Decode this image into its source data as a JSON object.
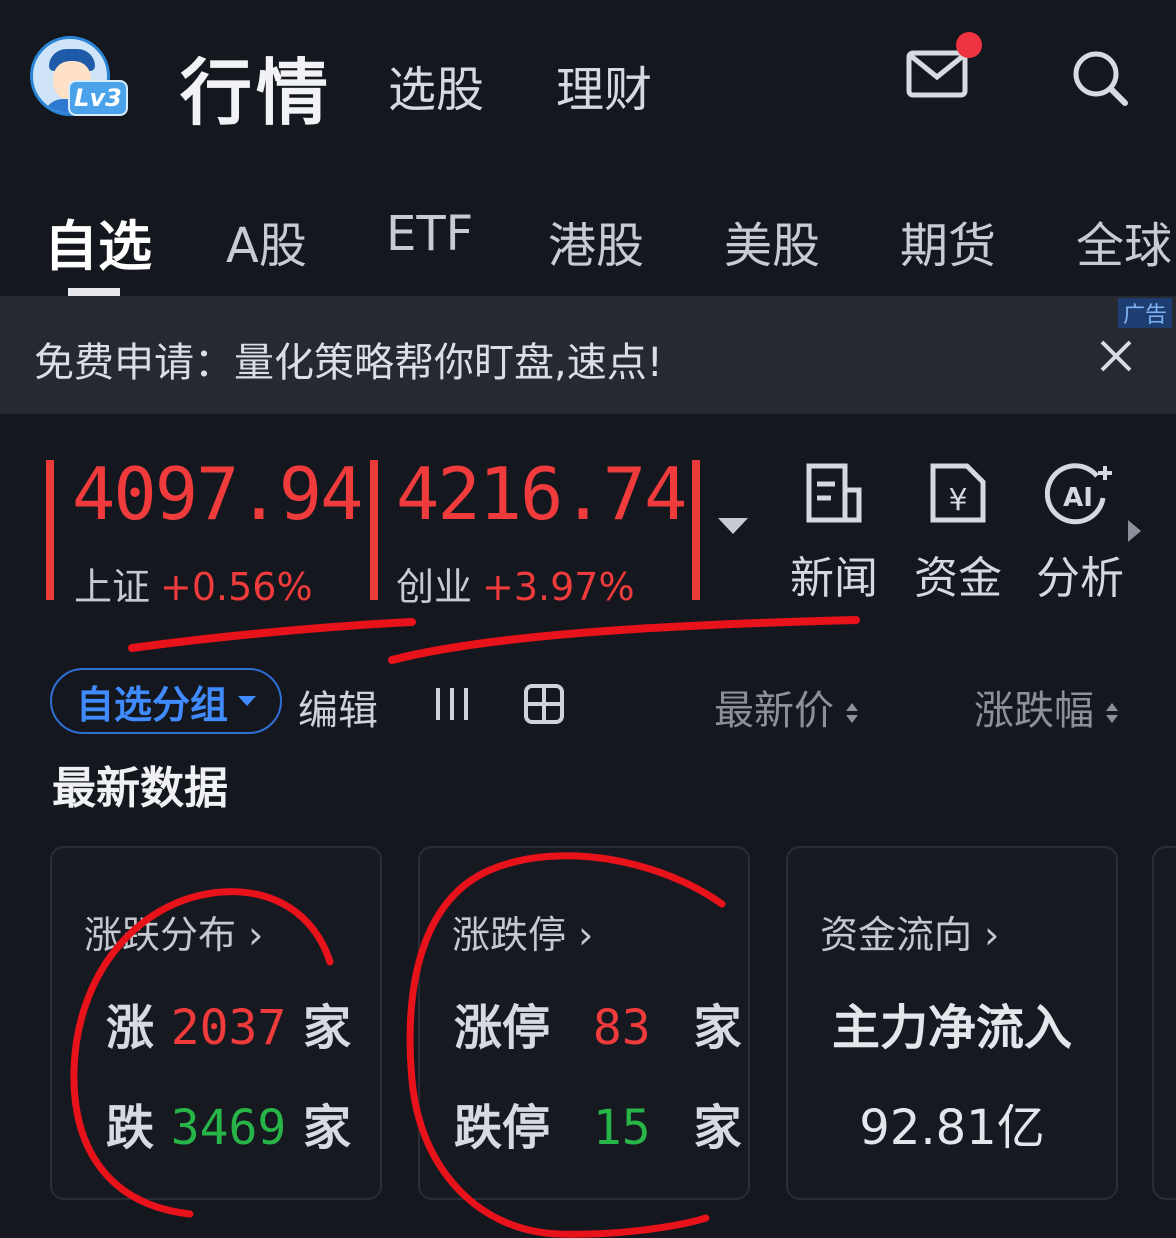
{
  "header": {
    "level_badge": "Lv3",
    "title": "行情",
    "nav": [
      "选股",
      "理财"
    ]
  },
  "tabs": [
    "自选",
    "A股",
    "ETF",
    "港股",
    "美股",
    "期货",
    "全球"
  ],
  "banner": {
    "text": "免费申请：量化策略帮你盯盘,速点!",
    "ad_label": "广告"
  },
  "indices": [
    {
      "value": "4097.94",
      "name": "上证",
      "change": "+0.56%"
    },
    {
      "value": "4216.74",
      "name": "创业",
      "change": "+3.97%"
    }
  ],
  "tools": [
    {
      "label": "新闻",
      "icon": "news-icon"
    },
    {
      "label": "资金",
      "icon": "fund-icon"
    },
    {
      "label": "分析",
      "icon": "ai-analysis-icon"
    }
  ],
  "filter": {
    "group_label": "自选分组",
    "edit_label": "编辑",
    "sort_price": "最新价",
    "sort_change": "涨跌幅"
  },
  "section_title": "最新数据",
  "cards": {
    "distribution": {
      "title": "涨跌分布 ›",
      "up_label": "涨",
      "up_count": "2037",
      "unit": "家",
      "down_label": "跌",
      "down_count": "3469"
    },
    "limit": {
      "title": "涨跌停 ›",
      "up_label": "涨停",
      "up_count": "83",
      "unit": "家",
      "down_label": "跌停",
      "down_count": "15"
    },
    "flow": {
      "title": "资金流向 ›",
      "label": "主力净流入",
      "value": "92.81亿"
    }
  },
  "colors": {
    "background": "#15171e",
    "rise": "#ef3b3b",
    "fall": "#27b548",
    "accent": "#3f8bff",
    "marker": "#e8121a"
  }
}
